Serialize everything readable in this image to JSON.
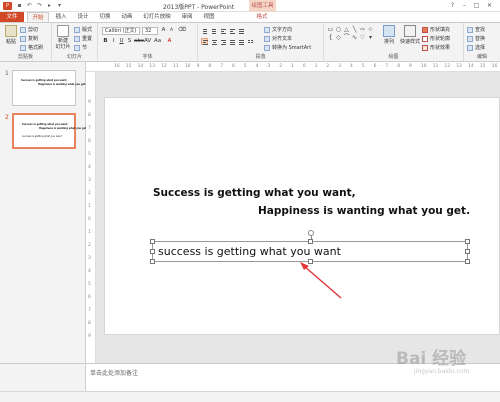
{
  "window": {
    "title": "2013版PPT - PowerPoint",
    "context_tab_group": "绘图工具",
    "app_icon": "P"
  },
  "quick_access": [
    "save-icon",
    "undo-icon",
    "redo-icon",
    "start-icon",
    "customize-icon"
  ],
  "tabs": [
    {
      "label": "文件"
    },
    {
      "label": "开始"
    },
    {
      "label": "插入"
    },
    {
      "label": "设计"
    },
    {
      "label": "切换"
    },
    {
      "label": "动画"
    },
    {
      "label": "幻灯片放映"
    },
    {
      "label": "审阅"
    },
    {
      "label": "视图"
    },
    {
      "label": "格式"
    }
  ],
  "ribbon": {
    "clipboard": {
      "paste": "粘贴",
      "cut": "剪切",
      "copy": "复制",
      "format_painter": "格式刷",
      "group": "剪贴板"
    },
    "slides": {
      "new_slide": "新建\n幻灯片",
      "layout": "版式",
      "reset": "重置",
      "section": "节",
      "group": "幻灯片"
    },
    "font": {
      "name": "Calibri (正文)",
      "size": "32",
      "group": "字体"
    },
    "paragraph": {
      "text_direction": "文字方向",
      "align_text": "对齐文本",
      "smartart": "转换为 SmartArt",
      "group": "段落"
    },
    "drawing": {
      "arrange": "排列",
      "quick_styles": "快速样式",
      "fill": "形状填充",
      "outline": "形状轮廓",
      "effects": "形状效果",
      "group": "绘图"
    },
    "editing": {
      "find": "查找",
      "replace": "替换",
      "select": "选择",
      "group": "编辑"
    }
  },
  "ruler_h_ticks": [
    "16",
    "15",
    "14",
    "13",
    "12",
    "11",
    "10",
    "9",
    "8",
    "7",
    "6",
    "5",
    "4",
    "3",
    "2",
    "1",
    "0",
    "1",
    "2",
    "3",
    "4",
    "5",
    "6",
    "7",
    "8",
    "9",
    "10",
    "11",
    "12",
    "13",
    "14",
    "15",
    "16"
  ],
  "ruler_v_ticks": [
    "9",
    "8",
    "7",
    "6",
    "5",
    "4",
    "3",
    "2",
    "1",
    "0",
    "1",
    "2",
    "3",
    "4",
    "5",
    "6",
    "7",
    "8",
    "9"
  ],
  "thumbnails": [
    {
      "number": "1",
      "line1": "Success is getting what you want,",
      "line2": "Happiness is wanting what you get."
    },
    {
      "number": "2",
      "line1": "Success is getting what you want,",
      "line2": "Happiness is wanting what you get.",
      "line3": "success is getting what you want"
    }
  ],
  "slide": {
    "line1": "Success is getting what you want,",
    "line2": "Happiness is wanting what you get.",
    "textbox": "success is getting what you want"
  },
  "notes": {
    "placeholder": "单击此处添加备注"
  },
  "watermark": {
    "text": "Bai 经验",
    "sub": "jingyan.baidu.com"
  },
  "colors": {
    "accent": "#d24726",
    "arrow": "#e0353a"
  }
}
